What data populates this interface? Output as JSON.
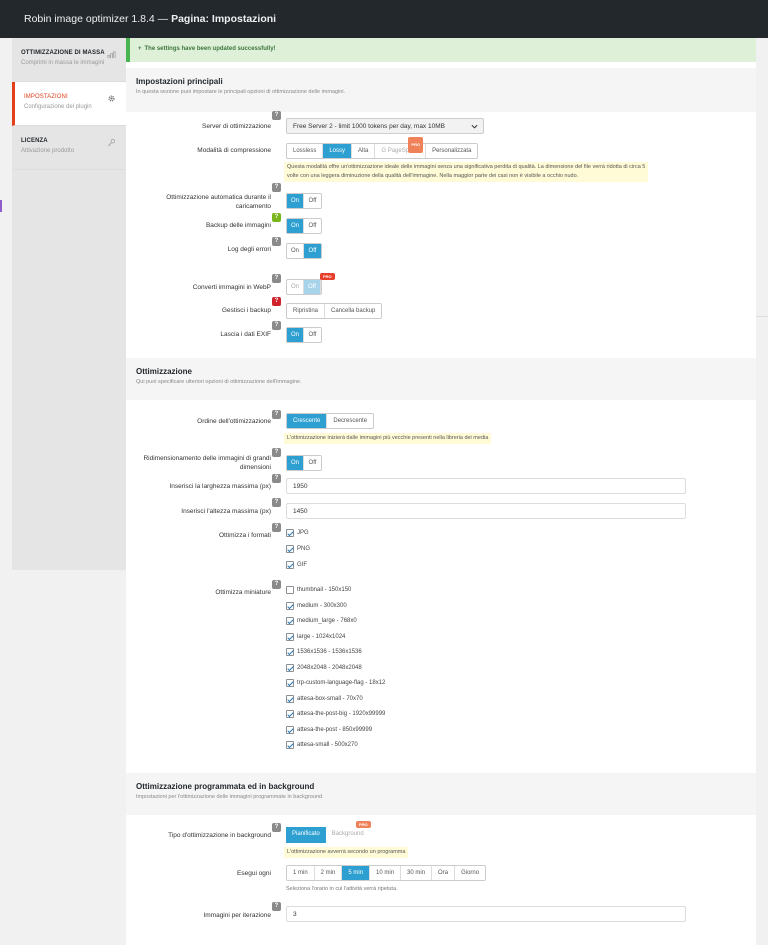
{
  "header": {
    "app_title": "Robin image optimizer 1.8.4 —",
    "page_title": "Pagina: Impostazioni"
  },
  "sidebar": {
    "items": [
      {
        "title": "OTTIMIZZAZIONE DI MASSA",
        "subtitle": "Comprimi in massa le immagini",
        "icon": "bar-chart-icon"
      },
      {
        "title": "IMPOSTAZIONI",
        "subtitle": "Configurazione del plugin",
        "icon": "gear-icon"
      },
      {
        "title": "LICENZA",
        "subtitle": "Attivazione prodotto",
        "icon": "key-icon"
      }
    ]
  },
  "notice": {
    "icon": "+",
    "text": "The settings have been updated successfully!"
  },
  "main_settings": {
    "title": "Impostazioni principali",
    "desc": "In questa sezione puoi impostare le principali opzioni di ottimizzazione delle immagini.",
    "server": {
      "label": "Server di ottimizzazione",
      "value": "Free Server 2 - limit 1000 tokens per day, max 10MB"
    },
    "compression": {
      "label": "Modalità di compressione",
      "options": [
        "Lossless",
        "Lossy",
        "Alta",
        "G PageSpeed",
        "Personalizzata"
      ],
      "selected": "Lossy",
      "pro_badge": "PRO",
      "hint_line1": "Questa modalità offre un'ottimizzazione ideale delle immagini senza una significativa perdita di qualità. La dimensione del file verrà ridotta di circa 5",
      "hint_line2": "volte con una leggera diminuzione della qualità dell'immagine. Nella maggior parte dei casi non è visibile a occhio nudo."
    },
    "auto_optimize": {
      "label_line1": "Ottimizzazione automatica durante il",
      "label_line2": "caricamento",
      "on": "On",
      "off": "Off",
      "value": "On"
    },
    "backup": {
      "label": "Backup delle immagini",
      "on": "On",
      "off": "Off",
      "value": "On"
    },
    "error_log": {
      "label": "Log degli errori",
      "on": "On",
      "off": "Off",
      "value": "Off"
    },
    "webp": {
      "label": "Converti immagini in WebP",
      "on": "On",
      "off": "Off",
      "value": "Off",
      "pro_badge": "PRO"
    },
    "manage_backup": {
      "label": "Gestisci i backup",
      "restore": "Ripristina",
      "delete": "Cancella backup"
    },
    "exif": {
      "label": "Lascia i dati EXIF",
      "on": "On",
      "off": "Off",
      "value": "On"
    }
  },
  "optimization": {
    "title": "Ottimizzazione",
    "desc": "Qui puoi specificare ulteriori opzioni di ottimizzazione dell'immagine.",
    "order": {
      "label": "Ordine dell'ottimizzazione",
      "options": [
        "Crescente",
        "Decrescente"
      ],
      "selected": "Crescente",
      "hint": "L'ottimizzazione inizierà dalle immagini più vecchie presenti nella libreria dei media"
    },
    "resize": {
      "label_line1": "Ridimensionamento delle immagini di grandi",
      "label_line2": "dimensioni",
      "on": "On",
      "off": "Off",
      "value": "On"
    },
    "max_width": {
      "label": "Inserisci la larghezza massima (px)",
      "value": "1950"
    },
    "max_height": {
      "label": "Inserisci l'altezza massima (px)",
      "value": "1450"
    },
    "formats": {
      "label": "Ottimizza i formati",
      "items": [
        {
          "name": "JPG",
          "checked": true
        },
        {
          "name": "PNG",
          "checked": true
        },
        {
          "name": "GIF",
          "checked": true
        }
      ]
    },
    "thumbnails": {
      "label": "Ottimizza miniature",
      "items": [
        {
          "name": "thumbnail - 150x150",
          "checked": false
        },
        {
          "name": "medium - 300x300",
          "checked": true
        },
        {
          "name": "medium_large - 768x0",
          "checked": true
        },
        {
          "name": "large - 1024x1024",
          "checked": true
        },
        {
          "name": "1536x1536 - 1536x1536",
          "checked": true
        },
        {
          "name": "2048x2048 - 2048x2048",
          "checked": true
        },
        {
          "name": "trp-custom-language-flag - 18x12",
          "checked": true
        },
        {
          "name": "attesa-box-small - 70x70",
          "checked": true
        },
        {
          "name": "attesa-the-post-big - 1920x99999",
          "checked": true
        },
        {
          "name": "attesa-the-post - 850x99999",
          "checked": true
        },
        {
          "name": "attesa-small - 500x270",
          "checked": true
        }
      ]
    }
  },
  "scheduled": {
    "title": "Ottimizzazione programmata ed in background",
    "desc": "Impostazioni per l'ottimizzazione delle immagini programmate in background.",
    "type": {
      "label": "Tipo d'ottimizzazione in background",
      "options": [
        "Pianificato",
        "Background"
      ],
      "selected": "Pianificato",
      "pro_badge": "PRO",
      "hint": "L'ottimizzazione avverrà secondo un programma"
    },
    "every": {
      "label": "Esegui ogni",
      "options": [
        "1 min",
        "2 min",
        "5 min",
        "10 min",
        "30 min",
        "Ora",
        "Giorno"
      ],
      "selected": "5 min",
      "note": "Seleziona l'orario in cui l'attività verrà ripetuta."
    },
    "per_iteration": {
      "label": "Immagini per iterazione",
      "value": "3"
    }
  },
  "help_icon_text": "?"
}
